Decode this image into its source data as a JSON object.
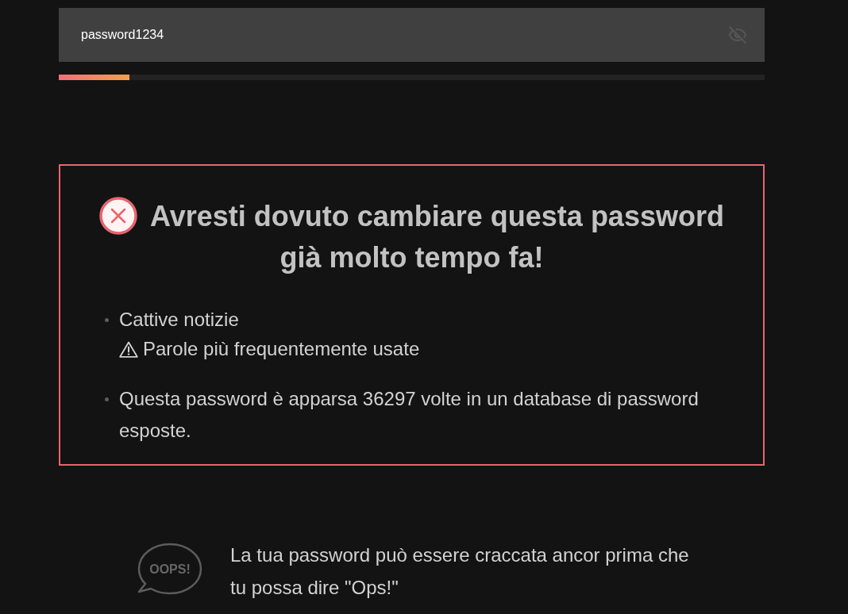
{
  "password_field": {
    "value": "password1234",
    "revealed": true
  },
  "strength_meter": {
    "level": 0.1
  },
  "alert": {
    "title": "Avresti dovuto cambiare questa password già molto tempo fa!",
    "items": [
      {
        "text": "Cattive notizie",
        "warnings": [
          "Parole più frequentemente usate"
        ]
      },
      {
        "text": "Questa password è apparsa 36297 volte in un database di password esposte."
      }
    ]
  },
  "tip": {
    "bubble_text": "OOPS!",
    "text": "La tua password può essere craccata ancor prima che tu possa dire \"Ops!\""
  }
}
